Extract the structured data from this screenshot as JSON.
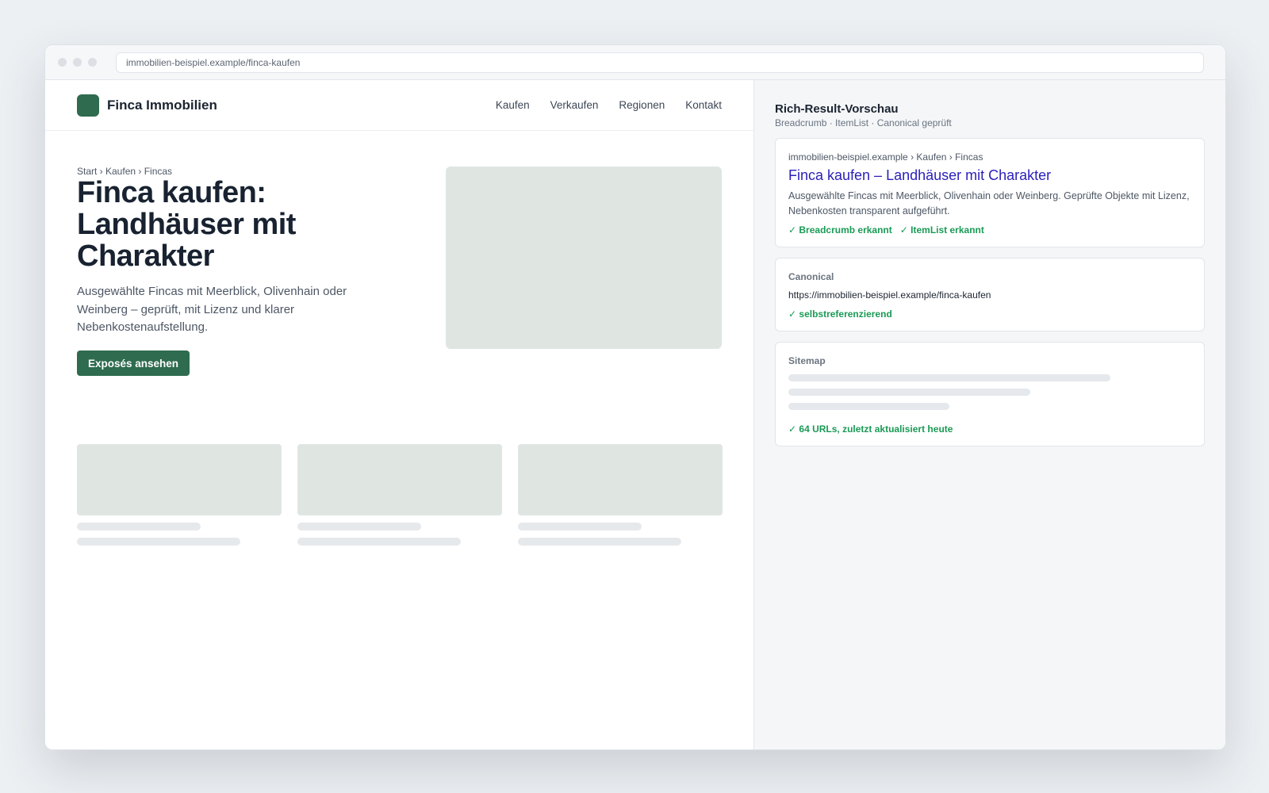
{
  "browser": {
    "url": "immobilien-beispiel.example/finca-kaufen"
  },
  "site": {
    "brand": "Finca Immobilien",
    "nav": [
      "Kaufen",
      "Verkaufen",
      "Regionen",
      "Kontakt"
    ],
    "breadcrumb": "Start › Kaufen › Fincas",
    "title": "Finca kaufen: Landhäuser mit Charakter",
    "lede": "Ausgewählte Fincas mit Meerblick, Olivenhain oder Weinberg – geprüft, mit Lizenz und klarer Nebenkostenaufstellung.",
    "cta": "Exposés ansehen"
  },
  "panel": {
    "title": "Rich-Result-Vorschau",
    "subtitle": "Breadcrumb · ItemList · Canonical geprüft",
    "serp": {
      "crumb": "immobilien-beispiel.example › Kaufen › Fincas",
      "title": "Finca kaufen – Landhäuser mit Charakter",
      "description": "Ausgewählte Fincas mit Meerblick, Olivenhain oder Weinberg. Geprüfte Objekte mit Lizenz, Nebenkosten transparent aufgeführt.",
      "checks": [
        "✓ Breadcrumb erkannt",
        "✓ ItemList erkannt"
      ]
    },
    "canonical": {
      "label": "Canonical",
      "url": "https://immobilien-beispiel.example/finca-kaufen",
      "check": "✓ selbstreferenzierend"
    },
    "sitemap": {
      "label": "Sitemap",
      "check": "✓ 64 URLs, zuletzt aktualisiert heute"
    }
  },
  "colors": {
    "brand": "#2e6b4f",
    "link": "#2a1fb8",
    "success": "#1a9a55",
    "placeholder": "#dfe6e2"
  }
}
